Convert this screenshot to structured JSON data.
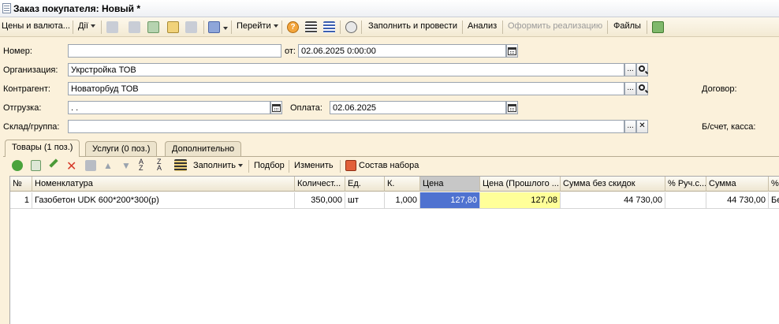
{
  "window": {
    "title": "Заказ покупателя: Новый *"
  },
  "toolbar": {
    "prices_label": "Цены и валюта...",
    "actions_label": "Дії",
    "goto_label": "Перейти",
    "fill_and_post_label": "Заполнить и провести",
    "analysis_label": "Анализ",
    "make_sale_label": "Оформить реализацию",
    "files_label": "Файлы"
  },
  "form": {
    "number_label": "Номер:",
    "number_value": "",
    "date_from_label": "от:",
    "date_value": "02.06.2025  0:00:00",
    "org_label": "Организация:",
    "org_value": "Укрстройка ТОВ",
    "counterparty_label": "Контрагент:",
    "counterparty_value": "Новаторбуд ТОВ",
    "contract_label": "Договор:",
    "shipment_label": "Отгрузка:",
    "shipment_value": "  .  .",
    "payment_label": "Оплата:",
    "payment_value": "02.06.2025",
    "warehouse_label": "Склад/группа:",
    "warehouse_value": "",
    "account_label": "Б/счет, касса:",
    "ellipsis": "...",
    "clear_x": "✕"
  },
  "tabs": [
    {
      "label": "Товары (1 поз.)",
      "active": true
    },
    {
      "label": "Услуги (0 поз.)",
      "active": false
    },
    {
      "label": "Дополнительно",
      "active": false
    }
  ],
  "table_toolbar": {
    "fill_label": "Заполнить",
    "selection_label": "Подбор",
    "change_label": "Изменить",
    "kit_label": "Состав набора"
  },
  "table": {
    "columns": [
      "№",
      "Номенклатура",
      "Количест...",
      "Ед.",
      "К.",
      "Цена",
      "Цена (Прошлого ...",
      "Сумма без скидок",
      "% Руч.с...",
      "Сумма",
      "%"
    ],
    "rows": [
      [
        "1",
        "Газобетон UDK 600*200*300(р)",
        "350,000",
        "шт",
        "1,000",
        "127,80",
        "127,08",
        "44 730,00",
        "",
        "44 730,00",
        "Бе"
      ]
    ]
  },
  "colors": {
    "background": "#FBF1DB",
    "selected_cell": "#4F72D0",
    "highlight_cell": "#FFFF99"
  }
}
